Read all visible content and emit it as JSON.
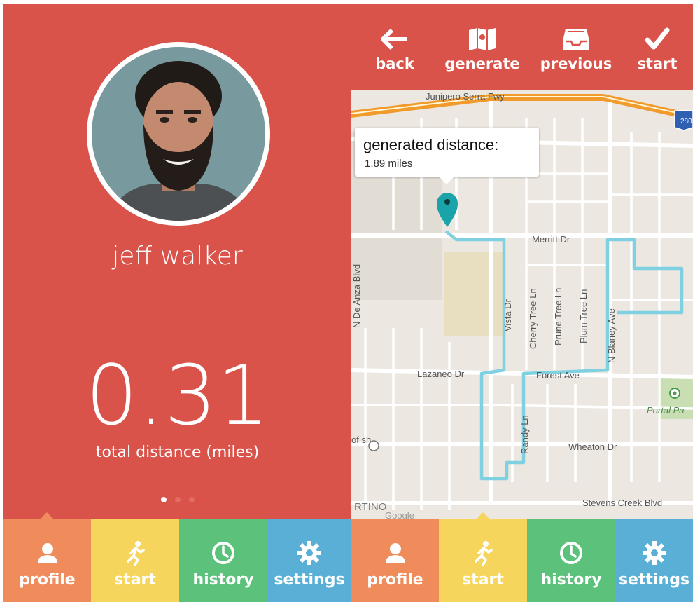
{
  "profile": {
    "name": "jeff walker",
    "total_distance": "0.31",
    "total_distance_label": "total distance (miles)"
  },
  "toolbar": {
    "back_label": "back",
    "generate_label": "generate",
    "previous_label": "previous",
    "start_label": "start"
  },
  "map": {
    "tooltip_title": "generated distance:",
    "tooltip_value": "1.89 miles",
    "streets": {
      "junipero": "Junipero Serra Fwy",
      "merritt": "Merritt Dr",
      "vista": "Vista Dr",
      "cherry": "Cherry Tree Ln",
      "prune": "Prune Tree Ln",
      "plum": "Plum Tree Ln",
      "blaney": "N Blaney Ave",
      "lazaneo": "Lazaneo Dr",
      "forest": "Forest Ave",
      "randy": "Randy Ln",
      "wheaton": "Wheaton Dr",
      "stevens": "Stevens Creek Blvd",
      "portal": "Portal Pa",
      "de_anza": "N De Anza Blvd",
      "highway_shield": "280",
      "of_sh": "of\nsh",
      "rtino": "RTINO",
      "google": "Google"
    },
    "route_color": "#7fd0e0",
    "pin_color": "#1aa3a8"
  },
  "tabs": {
    "profile": "profile",
    "start": "start",
    "history": "history",
    "settings": "settings"
  },
  "colors": {
    "background": "#d9534a",
    "tab_profile": "#f08c5b",
    "tab_start": "#f6d55c",
    "tab_history": "#5cc17a",
    "tab_settings": "#5aafd6"
  }
}
